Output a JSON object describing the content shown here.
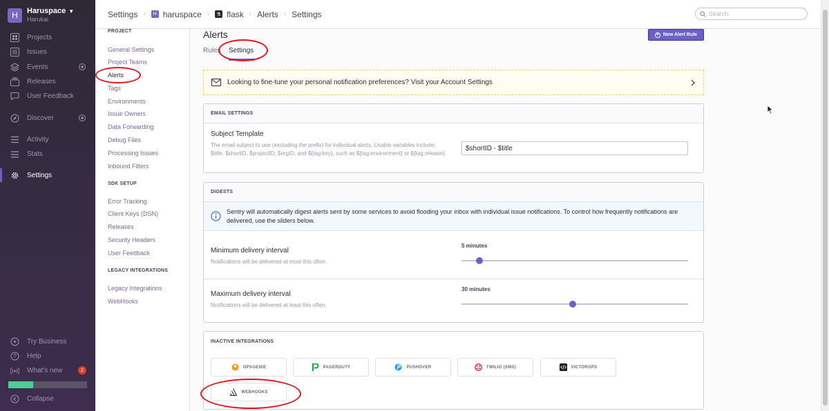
{
  "org": {
    "initial": "H",
    "name": "Haruspace",
    "user": "Harukai"
  },
  "sidebar": {
    "items": [
      {
        "label": "Projects",
        "icon": "projects-icon"
      },
      {
        "label": "Issues",
        "icon": "issues-icon"
      },
      {
        "label": "Events",
        "icon": "events-icon"
      },
      {
        "label": "Releases",
        "icon": "releases-icon"
      },
      {
        "label": "User Feedback",
        "icon": "user-feedback-icon"
      },
      {
        "label": "Discover",
        "icon": "discover-icon"
      },
      {
        "label": "Activity",
        "icon": "activity-icon"
      },
      {
        "label": "Stats",
        "icon": "stats-icon"
      },
      {
        "label": "Settings",
        "icon": "settings-icon"
      }
    ],
    "bottom": [
      {
        "label": "Try Business",
        "icon": "try-business-icon"
      },
      {
        "label": "Help",
        "icon": "help-icon"
      },
      {
        "label": "What's new",
        "icon": "broadcast-icon",
        "badge": "2"
      },
      {
        "label": "Collapse",
        "icon": "collapse-icon"
      }
    ],
    "progress": 0.32
  },
  "breadcrumb": {
    "root": "Settings",
    "org_initial": "H",
    "org": "haruspace",
    "project": "flask",
    "section": "Alerts",
    "page": "Settings"
  },
  "search": {
    "placeholder": "Search"
  },
  "settings_nav": {
    "project_heading": "PROJECT",
    "project_links": [
      "General Settings",
      "Project Teams",
      "Alerts",
      "Tags",
      "Environments",
      "Issue Owners",
      "Data Forwarding",
      "Debug Files",
      "Processing Issues",
      "Inbound Filters"
    ],
    "sdk_heading": "SDK SETUP",
    "sdk_links": [
      "Error Tracking",
      "Client Keys (DSN)",
      "Releases",
      "Security Headers",
      "User Feedback"
    ],
    "legacy_heading": "LEGACY INTEGRATIONS",
    "legacy_links": [
      "Legacy Integrations",
      "WebHooks"
    ]
  },
  "main": {
    "title": "Alerts",
    "new_rule_label": "New Alert Rule",
    "tabs": [
      {
        "label": "Rules"
      },
      {
        "label": "Settings"
      }
    ],
    "notice": "Looking to fine-tune your personal notification preferences? Visit your Account Settings",
    "email": {
      "header": "EMAIL SETTINGS",
      "subject_label": "Subject Template",
      "subject_help": "The email subject to use (excluding the prefix) for individual alerts. Usable variables include: $title, $shortID, $projectID, $orgID, and ${tag:key}, such as ${tag:environment} or ${tag:release}.",
      "subject_value": "$shortID - $title"
    },
    "digests": {
      "header": "DIGESTS",
      "info": "Sentry will automatically digest alerts sent by some services to avoid flooding your inbox with individual issue notifications. To control how frequently notifications are delivered, use the sliders below.",
      "min_label": "Minimum delivery interval",
      "min_help": "Notifications will be delivered at most this often.",
      "min_value": "5 minutes",
      "min_position": 0.08,
      "max_label": "Maximum delivery interval",
      "max_help": "Notifications will be delivered at least this often.",
      "max_value": "30 minutes",
      "max_position": 0.49
    },
    "integrations": {
      "header": "INACTIVE INTEGRATIONS",
      "items": [
        {
          "label": "OPSGENIE",
          "color": "#f79a1d"
        },
        {
          "label": "PAGERDUTY",
          "color": "#06ac38"
        },
        {
          "label": "PUSHOVER",
          "color": "#249df1"
        },
        {
          "label": "TWILIO (SMS)",
          "color": "#e31e26"
        },
        {
          "label": "VICTOROPS",
          "color": "#1c1c1c"
        },
        {
          "label": "WEBHOOKS",
          "color": "#2f2936"
        }
      ]
    }
  },
  "colors": {
    "accent": "#6c5fc7",
    "annotation": "#e8131c"
  }
}
